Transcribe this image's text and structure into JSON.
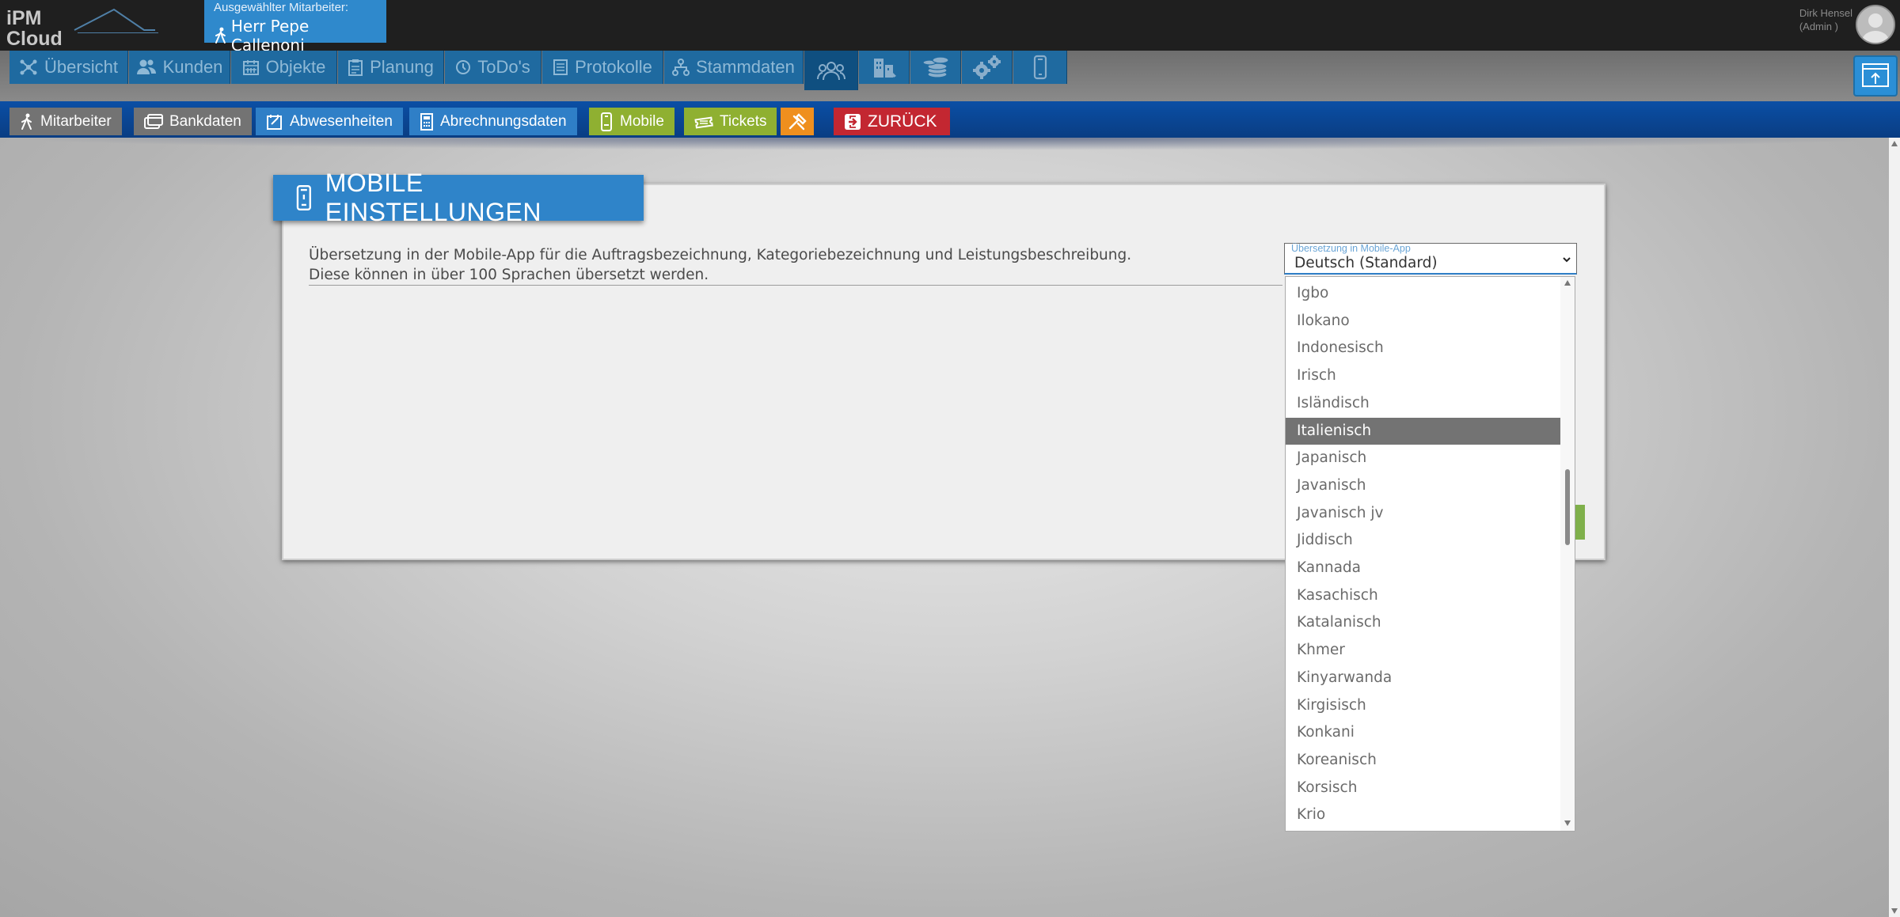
{
  "logo": {
    "text": "iPM\nCloud"
  },
  "employee": {
    "caption": "Ausgewählter Mitarbeiter:",
    "name": "Herr Pepe Callenoni"
  },
  "user": {
    "name": "Dirk Hensel",
    "role": "(Admin )"
  },
  "nav": {
    "tabs": [
      {
        "label": "Übersicht",
        "icon": "network-icon"
      },
      {
        "label": "Kunden",
        "icon": "users-icon"
      },
      {
        "label": "Objekte",
        "icon": "calendar-icon"
      },
      {
        "label": "Planung",
        "icon": "clipboard-icon"
      },
      {
        "label": "ToDo's",
        "icon": "clock-icon"
      },
      {
        "label": "Protokolle",
        "icon": "document-icon"
      },
      {
        "label": "Stammdaten",
        "icon": "hierarchy-icon"
      }
    ],
    "icon_tabs": [
      "people-icon",
      "buildings-icon",
      "coins-icon",
      "gears-icon",
      "mobile-icon"
    ],
    "active_icon_tab": "people-icon"
  },
  "subnav": {
    "buttons": [
      {
        "label": "Mitarbeiter",
        "icon": "walking-person-icon",
        "color": "gray"
      },
      {
        "label": "Bankdaten",
        "icon": "bank-card-icon",
        "color": "gray"
      },
      {
        "label": "Abwesenheiten",
        "icon": "calendar-edit-icon",
        "color": "blue"
      },
      {
        "label": "Abrechnungsdaten",
        "icon": "calculator-icon",
        "color": "blue"
      },
      {
        "label": "Mobile",
        "icon": "mobile-phone-icon",
        "color": "green"
      },
      {
        "label": "Tickets",
        "icon": "ticket-icon",
        "color": "green"
      },
      {
        "label": "",
        "icon": "tools-icon",
        "color": "orange"
      },
      {
        "label": "ZURÜCK",
        "icon": "exit-icon",
        "color": "red"
      }
    ]
  },
  "panel": {
    "title": "MOBILE EINSTELLUNGEN",
    "description_line1": "Übersetzung in der Mobile-App für die Auftragsbezeichnung, Kategoriebezeichnung und Leistungsbeschreibung.",
    "description_line2": "Diese können in über 100 Sprachen übersetzt werden."
  },
  "language_select": {
    "label": "Übersetzung in Mobile-App",
    "value": "Deutsch (Standard)",
    "options": [
      "Igbo",
      "Ilokano",
      "Indonesisch",
      "Irisch",
      "Isländisch",
      "Italienisch",
      "Japanisch",
      "Javanisch",
      "Javanisch jv",
      "Jiddisch",
      "Kannada",
      "Kasachisch",
      "Katalanisch",
      "Khmer",
      "Kinyarwanda",
      "Kirgisisch",
      "Konkani",
      "Koreanisch",
      "Korsisch",
      "Krio"
    ],
    "highlighted": "Italienisch"
  },
  "colors": {
    "accent_blue": "#2f84c9",
    "subbar_blue": "#0b4fa5",
    "green": "#8fb031",
    "orange": "#ef8f1e",
    "red": "#c32731",
    "topbar": "#1f1f1f"
  }
}
